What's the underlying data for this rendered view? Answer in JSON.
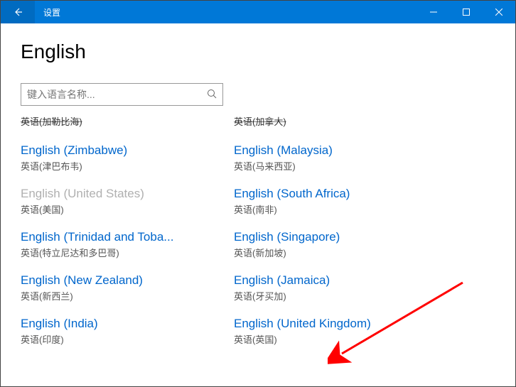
{
  "titlebar": {
    "title": "设置"
  },
  "page": {
    "title": "English"
  },
  "search": {
    "placeholder": "键入语言名称..."
  },
  "partial": {
    "left": "英语(加勒比海)",
    "right": "英语(加拿大)"
  },
  "languages": {
    "left": [
      {
        "name": "English (Zimbabwe)",
        "local": "英语(津巴布韦)",
        "disabled": false
      },
      {
        "name": "English (United States)",
        "local": "英语(美国)",
        "disabled": true
      },
      {
        "name": "English (Trinidad and Toba...",
        "local": "英语(特立尼达和多巴哥)",
        "disabled": false
      },
      {
        "name": "English (New Zealand)",
        "local": "英语(新西兰)",
        "disabled": false
      },
      {
        "name": "English (India)",
        "local": "英语(印度)",
        "disabled": false
      }
    ],
    "right": [
      {
        "name": "English (Malaysia)",
        "local": "英语(马来西亚)",
        "disabled": false
      },
      {
        "name": "English (South Africa)",
        "local": "英语(南非)",
        "disabled": false
      },
      {
        "name": "English (Singapore)",
        "local": "英语(新加坡)",
        "disabled": false
      },
      {
        "name": "English (Jamaica)",
        "local": "英语(牙买加)",
        "disabled": false
      },
      {
        "name": "English (United Kingdom)",
        "local": "英语(英国)",
        "disabled": false
      }
    ]
  }
}
